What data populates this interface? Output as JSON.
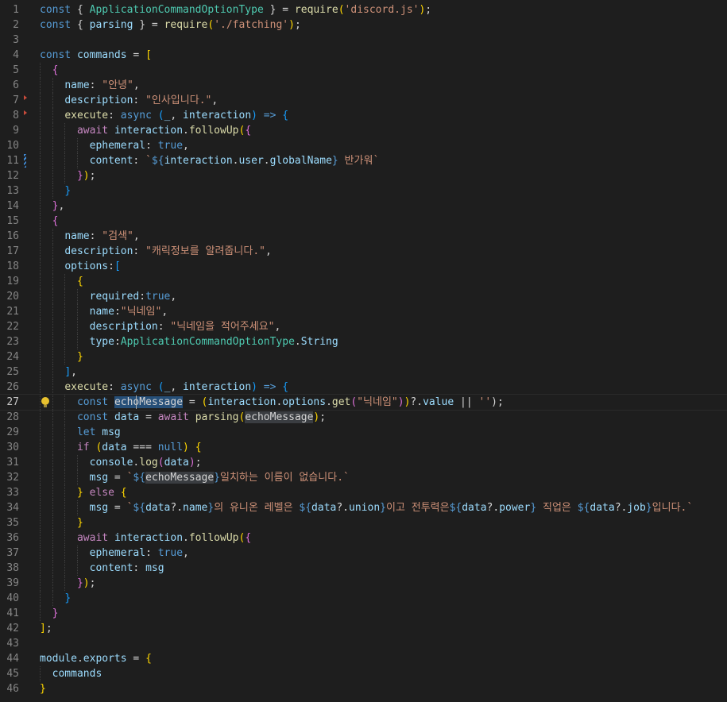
{
  "editor": {
    "active_line": "27",
    "lines": [
      {
        "n": "1",
        "tokens": [
          [
            "k",
            "const "
          ],
          [
            "p",
            "{ "
          ],
          [
            "t",
            "ApplicationCommandOptionType"
          ],
          [
            "p",
            " } = "
          ],
          [
            "f",
            "require"
          ],
          [
            "b1",
            "("
          ],
          [
            "s",
            "'discord.js'"
          ],
          [
            "b1",
            ")"
          ],
          [
            "p",
            ";"
          ]
        ]
      },
      {
        "n": "2",
        "tokens": [
          [
            "k",
            "const "
          ],
          [
            "p",
            "{ "
          ],
          [
            "v",
            "parsing"
          ],
          [
            "p",
            " } = "
          ],
          [
            "f",
            "require"
          ],
          [
            "b1",
            "("
          ],
          [
            "s",
            "'./fatching'"
          ],
          [
            "b1",
            ")"
          ],
          [
            "p",
            ";"
          ]
        ]
      },
      {
        "n": "3",
        "tokens": []
      },
      {
        "n": "4",
        "tokens": [
          [
            "k",
            "const "
          ],
          [
            "v",
            "commands"
          ],
          [
            "p",
            " = "
          ],
          [
            "b1",
            "["
          ]
        ]
      },
      {
        "n": "5",
        "tokens": [
          [
            "p",
            "  "
          ],
          [
            "b2",
            "{"
          ]
        ]
      },
      {
        "n": "6",
        "tokens": [
          [
            "p",
            "    "
          ],
          [
            "v",
            "name"
          ],
          [
            "p",
            ": "
          ],
          [
            "s",
            "\"안녕\""
          ],
          [
            "p",
            ","
          ]
        ]
      },
      {
        "n": "7",
        "tokens": [
          [
            "p",
            "    "
          ],
          [
            "v",
            "description"
          ],
          [
            "p",
            ": "
          ],
          [
            "s",
            "\"인사입니다.\""
          ],
          [
            "p",
            ","
          ]
        ]
      },
      {
        "n": "8",
        "tokens": [
          [
            "p",
            "    "
          ],
          [
            "f",
            "execute"
          ],
          [
            "p",
            ": "
          ],
          [
            "k",
            "async "
          ],
          [
            "b3",
            "("
          ],
          [
            "v",
            "_"
          ],
          [
            "p",
            ", "
          ],
          [
            "v",
            "interaction"
          ],
          [
            "b3",
            ")"
          ],
          [
            "k",
            " => "
          ],
          [
            "b3",
            "{"
          ]
        ]
      },
      {
        "n": "9",
        "tokens": [
          [
            "p",
            "      "
          ],
          [
            "c",
            "await "
          ],
          [
            "v",
            "interaction"
          ],
          [
            "p",
            "."
          ],
          [
            "f",
            "followUp"
          ],
          [
            "b1",
            "("
          ],
          [
            "b2",
            "{"
          ]
        ]
      },
      {
        "n": "10",
        "tokens": [
          [
            "p",
            "        "
          ],
          [
            "v",
            "ephemeral"
          ],
          [
            "p",
            ": "
          ],
          [
            "k",
            "true"
          ],
          [
            "p",
            ","
          ]
        ]
      },
      {
        "n": "11",
        "tokens": [
          [
            "p",
            "        "
          ],
          [
            "v",
            "content"
          ],
          [
            "p",
            ": "
          ],
          [
            "s",
            "`"
          ],
          [
            "tpl",
            "${"
          ],
          [
            "v",
            "interaction"
          ],
          [
            "p",
            "."
          ],
          [
            "v",
            "user"
          ],
          [
            "p",
            "."
          ],
          [
            "v",
            "globalName"
          ],
          [
            "tpl",
            "}"
          ],
          [
            "s",
            " 반가워`"
          ]
        ]
      },
      {
        "n": "12",
        "tokens": [
          [
            "p",
            "      "
          ],
          [
            "b2",
            "}"
          ],
          [
            "b1",
            ")"
          ],
          [
            "p",
            ";"
          ]
        ]
      },
      {
        "n": "13",
        "tokens": [
          [
            "p",
            "    "
          ],
          [
            "b3",
            "}"
          ]
        ]
      },
      {
        "n": "14",
        "tokens": [
          [
            "p",
            "  "
          ],
          [
            "b2",
            "}"
          ],
          [
            "p",
            ","
          ]
        ]
      },
      {
        "n": "15",
        "tokens": [
          [
            "p",
            "  "
          ],
          [
            "b2",
            "{"
          ]
        ]
      },
      {
        "n": "16",
        "tokens": [
          [
            "p",
            "    "
          ],
          [
            "v",
            "name"
          ],
          [
            "p",
            ": "
          ],
          [
            "s",
            "\"검색\""
          ],
          [
            "p",
            ","
          ]
        ]
      },
      {
        "n": "17",
        "tokens": [
          [
            "p",
            "    "
          ],
          [
            "v",
            "description"
          ],
          [
            "p",
            ": "
          ],
          [
            "s",
            "\"캐릭정보를 알려줍니다.\""
          ],
          [
            "p",
            ","
          ]
        ]
      },
      {
        "n": "18",
        "tokens": [
          [
            "p",
            "    "
          ],
          [
            "v",
            "options"
          ],
          [
            "p",
            ":"
          ],
          [
            "b3",
            "["
          ]
        ]
      },
      {
        "n": "19",
        "tokens": [
          [
            "p",
            "      "
          ],
          [
            "b1",
            "{"
          ]
        ]
      },
      {
        "n": "20",
        "tokens": [
          [
            "p",
            "        "
          ],
          [
            "v",
            "required"
          ],
          [
            "p",
            ":"
          ],
          [
            "k",
            "true"
          ],
          [
            "p",
            ","
          ]
        ]
      },
      {
        "n": "21",
        "tokens": [
          [
            "p",
            "        "
          ],
          [
            "v",
            "name"
          ],
          [
            "p",
            ":"
          ],
          [
            "s",
            "\"닉네임\""
          ],
          [
            "p",
            ","
          ]
        ]
      },
      {
        "n": "22",
        "tokens": [
          [
            "p",
            "        "
          ],
          [
            "v",
            "description"
          ],
          [
            "p",
            ": "
          ],
          [
            "s",
            "\"닉네임을 적어주세요\""
          ],
          [
            "p",
            ","
          ]
        ]
      },
      {
        "n": "23",
        "tokens": [
          [
            "p",
            "        "
          ],
          [
            "v",
            "type"
          ],
          [
            "p",
            ":"
          ],
          [
            "t",
            "ApplicationCommandOptionType"
          ],
          [
            "p",
            "."
          ],
          [
            "v",
            "String"
          ]
        ]
      },
      {
        "n": "24",
        "tokens": [
          [
            "p",
            "      "
          ],
          [
            "b1",
            "}"
          ]
        ]
      },
      {
        "n": "25",
        "tokens": [
          [
            "p",
            "    "
          ],
          [
            "b3",
            "]"
          ],
          [
            "p",
            ","
          ]
        ]
      },
      {
        "n": "26",
        "tokens": [
          [
            "p",
            "    "
          ],
          [
            "f",
            "execute"
          ],
          [
            "p",
            ": "
          ],
          [
            "k",
            "async "
          ],
          [
            "b3",
            "("
          ],
          [
            "v",
            "_"
          ],
          [
            "p",
            ", "
          ],
          [
            "v",
            "interaction"
          ],
          [
            "b3",
            ")"
          ],
          [
            "k",
            " => "
          ],
          [
            "b3",
            "{"
          ]
        ]
      },
      {
        "n": "27",
        "tokens": [
          [
            "p",
            "      "
          ],
          [
            "k",
            "const "
          ],
          [
            "hl",
            "echoMessage"
          ],
          [
            "p",
            " = "
          ],
          [
            "b1",
            "("
          ],
          [
            "v",
            "interaction"
          ],
          [
            "p",
            "."
          ],
          [
            "v",
            "options"
          ],
          [
            "p",
            "."
          ],
          [
            "f",
            "get"
          ],
          [
            "b2",
            "("
          ],
          [
            "s",
            "\"닉네임\""
          ],
          [
            "b2",
            ")"
          ],
          [
            "b1",
            ")"
          ],
          [
            "p",
            "?."
          ],
          [
            "v",
            "value"
          ],
          [
            "p",
            " || "
          ],
          [
            "s",
            "''"
          ],
          [
            "p",
            ");"
          ]
        ]
      },
      {
        "n": "28",
        "tokens": [
          [
            "p",
            "      "
          ],
          [
            "k",
            "const "
          ],
          [
            "v",
            "data"
          ],
          [
            "p",
            " = "
          ],
          [
            "c",
            "await "
          ],
          [
            "f",
            "parsing"
          ],
          [
            "b1",
            "("
          ],
          [
            "hl2",
            "echoMessage"
          ],
          [
            "b1",
            ")"
          ],
          [
            "p",
            ";"
          ]
        ]
      },
      {
        "n": "29",
        "tokens": [
          [
            "p",
            "      "
          ],
          [
            "k",
            "let "
          ],
          [
            "v",
            "msg"
          ]
        ]
      },
      {
        "n": "30",
        "tokens": [
          [
            "p",
            "      "
          ],
          [
            "c",
            "if "
          ],
          [
            "b1",
            "("
          ],
          [
            "v",
            "data"
          ],
          [
            "p",
            " === "
          ],
          [
            "k",
            "null"
          ],
          [
            "b1",
            ")"
          ],
          [
            "p",
            " "
          ],
          [
            "b1",
            "{"
          ]
        ]
      },
      {
        "n": "31",
        "tokens": [
          [
            "p",
            "        "
          ],
          [
            "v",
            "console"
          ],
          [
            "p",
            "."
          ],
          [
            "f",
            "log"
          ],
          [
            "b2",
            "("
          ],
          [
            "v",
            "data"
          ],
          [
            "b2",
            ")"
          ],
          [
            "p",
            ";"
          ]
        ]
      },
      {
        "n": "32",
        "tokens": [
          [
            "p",
            "        "
          ],
          [
            "v",
            "msg"
          ],
          [
            "p",
            " = "
          ],
          [
            "s",
            "`"
          ],
          [
            "tpl",
            "${"
          ],
          [
            "hl2",
            "echoMessage"
          ],
          [
            "tpl",
            "}"
          ],
          [
            "s",
            "일치하는 이름이 없습니다.`"
          ]
        ]
      },
      {
        "n": "33",
        "tokens": [
          [
            "p",
            "      "
          ],
          [
            "b1",
            "}"
          ],
          [
            "c",
            " else "
          ],
          [
            "b1",
            "{"
          ]
        ]
      },
      {
        "n": "34",
        "tokens": [
          [
            "p",
            "        "
          ],
          [
            "v",
            "msg"
          ],
          [
            "p",
            " = "
          ],
          [
            "s",
            "`"
          ],
          [
            "tpl",
            "${"
          ],
          [
            "v",
            "data"
          ],
          [
            "p",
            "?."
          ],
          [
            "v",
            "name"
          ],
          [
            "tpl",
            "}"
          ],
          [
            "s",
            "의 유니온 레벨은 "
          ],
          [
            "tpl",
            "${"
          ],
          [
            "v",
            "data"
          ],
          [
            "p",
            "?."
          ],
          [
            "v",
            "union"
          ],
          [
            "tpl",
            "}"
          ],
          [
            "s",
            "이고 전투력은"
          ],
          [
            "tpl",
            "${"
          ],
          [
            "v",
            "data"
          ],
          [
            "p",
            "?."
          ],
          [
            "v",
            "power"
          ],
          [
            "tpl",
            "}"
          ],
          [
            "s",
            " 직업은 "
          ],
          [
            "tpl",
            "${"
          ],
          [
            "v",
            "data"
          ],
          [
            "p",
            "?."
          ],
          [
            "v",
            "job"
          ],
          [
            "tpl",
            "}"
          ],
          [
            "s",
            "입니다.`"
          ]
        ]
      },
      {
        "n": "35",
        "tokens": [
          [
            "p",
            "      "
          ],
          [
            "b1",
            "}"
          ]
        ]
      },
      {
        "n": "36",
        "tokens": [
          [
            "p",
            "      "
          ],
          [
            "c",
            "await "
          ],
          [
            "v",
            "interaction"
          ],
          [
            "p",
            "."
          ],
          [
            "f",
            "followUp"
          ],
          [
            "b1",
            "("
          ],
          [
            "b2",
            "{"
          ]
        ]
      },
      {
        "n": "37",
        "tokens": [
          [
            "p",
            "        "
          ],
          [
            "v",
            "ephemeral"
          ],
          [
            "p",
            ": "
          ],
          [
            "k",
            "true"
          ],
          [
            "p",
            ","
          ]
        ]
      },
      {
        "n": "38",
        "tokens": [
          [
            "p",
            "        "
          ],
          [
            "v",
            "content"
          ],
          [
            "p",
            ": "
          ],
          [
            "v",
            "msg"
          ]
        ]
      },
      {
        "n": "39",
        "tokens": [
          [
            "p",
            "      "
          ],
          [
            "b2",
            "}"
          ],
          [
            "b1",
            ")"
          ],
          [
            "p",
            ";"
          ]
        ]
      },
      {
        "n": "40",
        "tokens": [
          [
            "p",
            "    "
          ],
          [
            "b3",
            "}"
          ]
        ]
      },
      {
        "n": "41",
        "tokens": [
          [
            "p",
            "  "
          ],
          [
            "b2",
            "}"
          ]
        ]
      },
      {
        "n": "42",
        "tokens": [
          [
            "b1",
            "]"
          ],
          [
            "p",
            ";"
          ]
        ]
      },
      {
        "n": "43",
        "tokens": []
      },
      {
        "n": "44",
        "tokens": [
          [
            "v",
            "module"
          ],
          [
            "p",
            "."
          ],
          [
            "v",
            "exports"
          ],
          [
            "p",
            " = "
          ],
          [
            "b1",
            "{"
          ]
        ]
      },
      {
        "n": "45",
        "tokens": [
          [
            "p",
            "  "
          ],
          [
            "v",
            "commands"
          ]
        ]
      },
      {
        "n": "46",
        "tokens": [
          [
            "b1",
            "}"
          ]
        ]
      }
    ]
  },
  "icons": {
    "lightbulb": "lightbulb-icon",
    "fold": "fold-arrow-icon",
    "diff": "modified-line-icon"
  },
  "colors": {
    "background": "#1e1e1e",
    "keyword": "#569cd6",
    "string": "#ce9178",
    "function": "#dcdcaa",
    "variable": "#9cdcfe",
    "type": "#4ec9b0"
  }
}
